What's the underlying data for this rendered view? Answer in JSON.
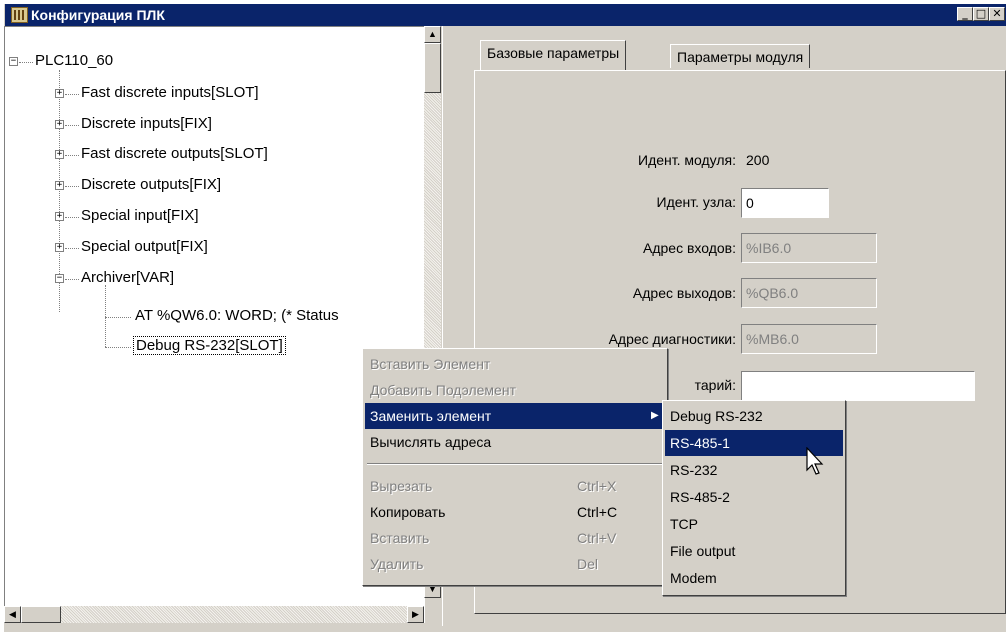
{
  "window": {
    "title": "Конфигурация ПЛК",
    "min": "_",
    "max": "□",
    "close": "✕"
  },
  "tree": {
    "root": "PLC110_60",
    "items": [
      {
        "label": "Fast discrete inputs[SLOT]"
      },
      {
        "label": "Discrete inputs[FIX]"
      },
      {
        "label": "Fast discrete outputs[SLOT]"
      },
      {
        "label": "Discrete outputs[FIX]"
      },
      {
        "label": "Special input[FIX]"
      },
      {
        "label": "Special output[FIX]"
      },
      {
        "label": "Archiver[VAR]"
      }
    ],
    "archiver_children": [
      {
        "label": "AT %QW6.0: WORD; (* Status"
      },
      {
        "label": "Debug RS-232[SLOT]"
      }
    ]
  },
  "tabs": [
    {
      "label": "Базовые параметры"
    },
    {
      "label": "Параметры модуля"
    }
  ],
  "form": {
    "module_id_label": "Идент. модуля:",
    "module_id_value": "200",
    "node_id_label": "Идент. узла:",
    "node_id_value": "0",
    "input_addr_label": "Адрес входов:",
    "input_addr_value": "%IB6.0",
    "output_addr_label": "Адрес выходов:",
    "output_addr_value": "%QB6.0",
    "diag_addr_label": "Адрес диагностики:",
    "diag_addr_value": "%MB6.0",
    "comment_label": "тарий:",
    "comment_value": ""
  },
  "context_menu": {
    "items": [
      {
        "label": "Вставить Элемент",
        "shortcut": ""
      },
      {
        "label": "Добавить Подэлемент",
        "shortcut": ""
      },
      {
        "label": "Заменить элемент",
        "shortcut": ""
      },
      {
        "label": "Вычислять адреса",
        "shortcut": ""
      },
      {
        "label": "Вырезать",
        "shortcut": "Ctrl+X"
      },
      {
        "label": "Копировать",
        "shortcut": "Ctrl+C"
      },
      {
        "label": "Вставить",
        "shortcut": "Ctrl+V"
      },
      {
        "label": "Удалить",
        "shortcut": "Del"
      }
    ],
    "submenu_arrow": "▶"
  },
  "submenu": {
    "items": [
      {
        "label": "Debug RS-232"
      },
      {
        "label": "RS-485-1"
      },
      {
        "label": "RS-232"
      },
      {
        "label": "RS-485-2"
      },
      {
        "label": "TCP"
      },
      {
        "label": "File output"
      },
      {
        "label": "Modem"
      }
    ]
  },
  "scroll": {
    "up": "▲",
    "down": "▼",
    "left": "◀",
    "right": "▶"
  },
  "colors": {
    "titlebar": "#0a246a",
    "highlight": "#0a246a",
    "face": "#d4d0c8"
  }
}
